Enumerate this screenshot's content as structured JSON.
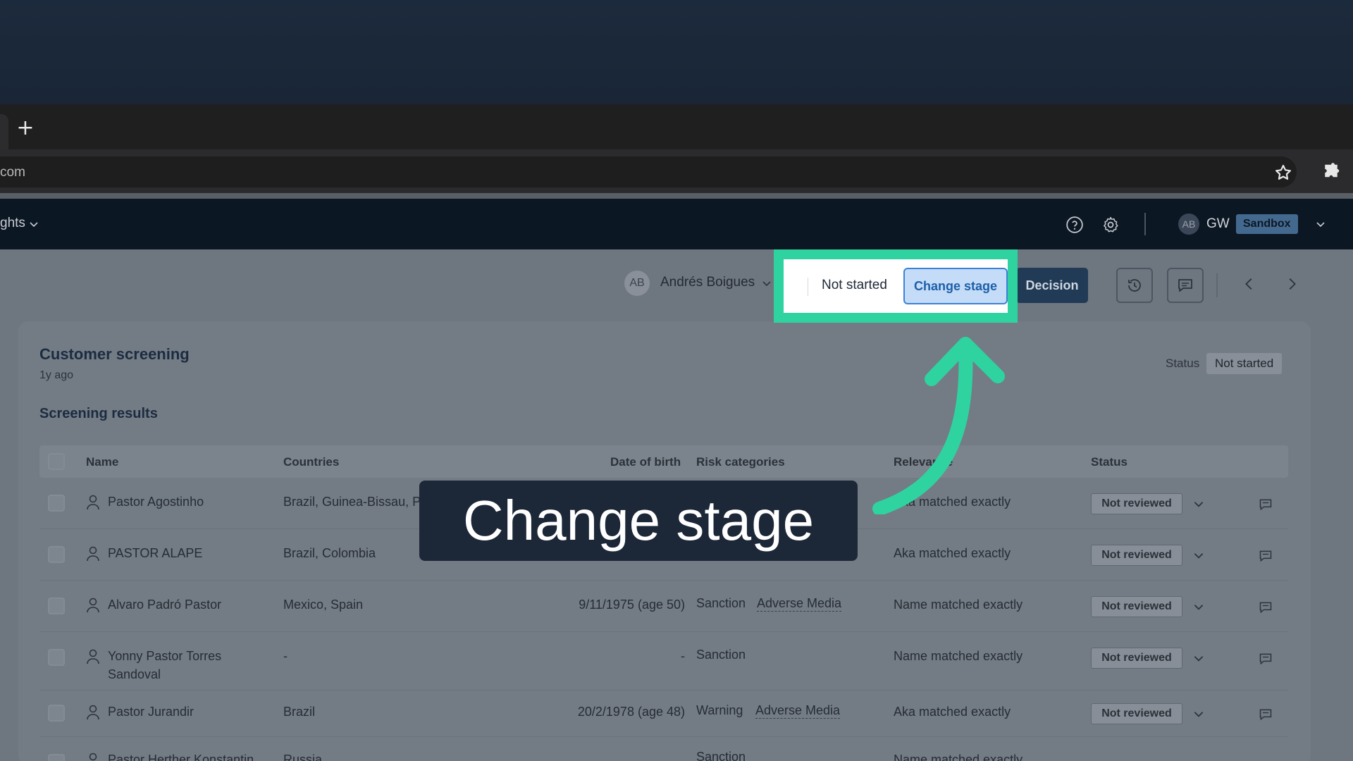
{
  "browser": {
    "new_tab_glyph": "+",
    "address_fragment": "com"
  },
  "header": {
    "nav_fragment": "ghts",
    "user_initials": "AB",
    "org_code": "GW",
    "environment": "Sandbox"
  },
  "toolbar": {
    "assignee_initials": "AB",
    "assignee_name": "Andrés Boigues",
    "stage": "Not started",
    "change_stage_label": "Change stage",
    "decision_label": "Decision"
  },
  "card": {
    "title": "Customer screening",
    "time": "1y ago",
    "status_label": "Status",
    "status_value": "Not started",
    "section_title": "Screening results"
  },
  "table": {
    "columns": [
      "Name",
      "Countries",
      "Date of birth",
      "Risk categories",
      "Relevance",
      "Status"
    ],
    "rows": [
      {
        "name": "Pastor Agostinho",
        "countries": "Brazil, Guinea-Bissau, P",
        "dob": "",
        "risk": "",
        "risk2": "",
        "relevance": "Aka matched exactly",
        "status": "Not reviewed"
      },
      {
        "name": "PASTOR ALAPE",
        "countries": "Brazil, Colombia",
        "dob": "",
        "risk": "",
        "risk2": "",
        "relevance": "Aka matched exactly",
        "status": "Not reviewed"
      },
      {
        "name": "Alvaro Padró Pastor",
        "countries": "Mexico, Spain",
        "dob": "9/11/1975 (age 50)",
        "risk": "Sanction",
        "risk2": "Adverse Media",
        "relevance": "Name matched exactly",
        "status": "Not reviewed"
      },
      {
        "name": "Yonny Pastor Torres",
        "name2": "Sandoval",
        "countries": "-",
        "dob": "-",
        "risk": "Sanction",
        "risk2": "",
        "relevance": "Name matched exactly",
        "status": "Not reviewed"
      },
      {
        "name": "Pastor Jurandir",
        "countries": "Brazil",
        "dob": "20/2/1978 (age 48)",
        "risk": "Warning",
        "risk2": "Adverse Media",
        "relevance": "Aka matched exactly",
        "status": "Not reviewed"
      },
      {
        "name": "Pastor Herther Konstantin",
        "countries": "Russia",
        "dob": "",
        "risk": "Sanction",
        "risk2": "",
        "relevance": "Name matched exactly",
        "status": ""
      }
    ]
  },
  "overlay": {
    "caption": "Change stage"
  },
  "colors": {
    "highlight": "#2fd3a0",
    "change_stage_bg": "#c4dcf8",
    "decision_bg": "#213a55",
    "caption_bg": "#1c2738"
  }
}
